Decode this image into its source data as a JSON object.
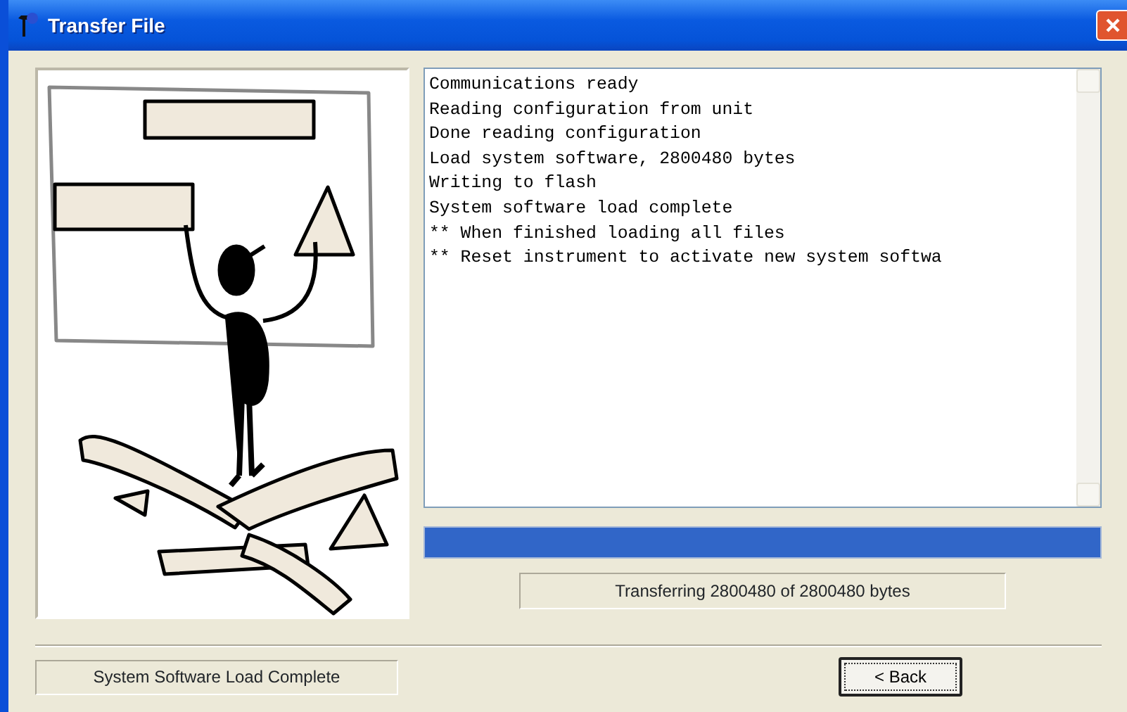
{
  "window": {
    "title": "Transfer File"
  },
  "log": {
    "lines": [
      "Communications ready",
      "Reading configuration from unit",
      "Done reading configuration",
      "Load system software, 2800480 bytes",
      "Writing to flash",
      "System software load complete",
      "** When finished loading all files",
      "** Reset instrument to activate new system softwa"
    ]
  },
  "progress": {
    "level": 1,
    "status": "Transferring 2800480 of 2800480 bytes"
  },
  "status_bar": "System Software Load Complete",
  "buttons": [
    {
      "label": "< Back"
    }
  ]
}
